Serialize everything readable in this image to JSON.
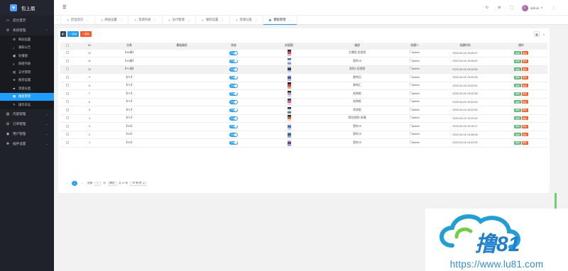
{
  "sidebar": {
    "brand": "包上届",
    "items": [
      {
        "label": "后台首页",
        "icon": "monitor-icon"
      },
      {
        "label": "系统管理",
        "icon": "gear-icon",
        "expanded": true,
        "children": [
          {
            "label": "网站设置",
            "icon": "gear-icon",
            "active": false
          },
          {
            "label": "通知公告",
            "icon": "bell-icon",
            "active": false
          },
          {
            "label": "轮播图",
            "icon": "image-icon",
            "active": false
          },
          {
            "label": "链接列表",
            "icon": "list-icon",
            "active": false
          },
          {
            "label": "支付管理",
            "icon": "card-icon",
            "active": false
          },
          {
            "label": "推荐设置",
            "icon": "star-icon",
            "active": false
          },
          {
            "label": "资源分类",
            "icon": "folder-icon",
            "active": false
          },
          {
            "label": "模板管理",
            "icon": "grid-icon",
            "active": true
          },
          {
            "label": "操作日志",
            "icon": "log-icon",
            "active": false
          }
        ]
      },
      {
        "label": "内容管理",
        "icon": "doc-icon"
      },
      {
        "label": "订单管理",
        "icon": "cart-icon"
      },
      {
        "label": "用户管理",
        "icon": "user-icon"
      },
      {
        "label": "插件设置",
        "icon": "plugin-icon"
      }
    ]
  },
  "header": {
    "menu_toggle": "☰",
    "user": "admin"
  },
  "tabs": [
    {
      "label": "后台首页",
      "active": false
    },
    {
      "label": "网站设置",
      "active": false
    },
    {
      "label": "资源列表",
      "active": false
    },
    {
      "label": "支付管理",
      "active": false
    },
    {
      "label": "推荐设置",
      "active": false
    },
    {
      "label": "资源分类",
      "active": false
    },
    {
      "label": "模板管理",
      "active": true
    }
  ],
  "toolbar": {
    "add": "+ 添加",
    "delete": "× 删除"
  },
  "table": {
    "headers": [
      "",
      "ID",
      "分类",
      "模板路径",
      "状态",
      "封面图",
      "描述",
      "创建人",
      "创建时间",
      "操作"
    ],
    "rows": [
      {
        "id": "12",
        "cat": "【H5端】",
        "desc": "主播我-短视频",
        "creator": "门admin",
        "time": "2022-04-04 15:45:37",
        "status": "开启",
        "thumb": [
          "#2a2a4a",
          "#c94a6b",
          "#f0b0c0"
        ]
      },
      {
        "id": "11",
        "cat": "【H5端】",
        "desc": "我的2E",
        "creator": "门admin",
        "time": "2022-04-04 15:45:52",
        "status": "开启",
        "thumb": [
          "#3a6fb0",
          "#e6e6f0",
          "#8a9ac8"
        ]
      },
      {
        "id": "10",
        "cat": "【PC端】",
        "desc": "我的2-短视频",
        "creator": "门admin",
        "time": "2022-04-04 15:44:56",
        "status": "开启",
        "thumb": [
          "#d0d0e0",
          "#2b3a6a",
          "#c0c8e0"
        ]
      },
      {
        "id": "9",
        "cat": "【PC】",
        "desc": "都商品",
        "creator": "门admin",
        "time": "2022-04-04 15:43:46",
        "status": "开启",
        "thumb": [
          "#e0e4f0",
          "#4a5a9a",
          "#a8b8e0"
        ]
      },
      {
        "id": "8",
        "cat": "【PC】",
        "desc": "都商汇",
        "creator": "门admin",
        "time": "2022-04-04 15:42:51",
        "status": "开启",
        "thumb": [
          "#1a1a2a",
          "#c84a5a",
          "#e8a060"
        ]
      },
      {
        "id": "7",
        "cat": "【PC】",
        "desc": "经典版",
        "creator": "门admin",
        "time": "2022-04-04 15:42:06",
        "status": "开启",
        "thumb": [
          "#2a2a3a",
          "#b8a0d0",
          "#e0e0f0"
        ]
      },
      {
        "id": "6",
        "cat": "【PC】",
        "desc": "经典版",
        "creator": "门admin",
        "time": "2022-04-04 15:33:49",
        "status": "开启",
        "thumb": [
          "#3a3a6a",
          "#e06080",
          "#f0d0d8"
        ]
      },
      {
        "id": "5",
        "cat": "【PC】",
        "desc": "简易版",
        "creator": "门admin",
        "time": "2022-04-04 15:32:50",
        "status": "开启",
        "thumb": [
          "#1a2a4a",
          "#e0e0e8",
          "#6a7ab0"
        ]
      },
      {
        "id": "4",
        "cat": "【PC】",
        "desc": "简短视频+直播",
        "creator": "门admin",
        "time": "2022-04-04 15:20:43",
        "status": "开启",
        "thumb": [
          "#2a2a2a",
          "#d07040",
          "#f0e0c0"
        ]
      },
      {
        "id": "3",
        "cat": "【H5】",
        "desc": "我的2E",
        "creator": "门admin",
        "time": "2022-04-04 15:15:17",
        "status": "开启",
        "thumb": [
          "#e8e8f0",
          "#4a70c0",
          "#c0c8e8"
        ]
      },
      {
        "id": "2",
        "cat": "【H5】",
        "desc": "我的2E",
        "creator": "门admin",
        "time": "2022-04-04 14:48:08",
        "status": "开启",
        "thumb": [
          "#f0f0f4",
          "#3a5a9a",
          "#90a0d0"
        ]
      },
      {
        "id": "1",
        "cat": "【H5】",
        "desc": "我的2E",
        "creator": "门admin",
        "time": "2022-04-04 14:32:05",
        "status": "开启",
        "thumb": [
          "#d8d8e8",
          "#5a4a8a",
          "#b0a0d8"
        ]
      }
    ],
    "op_edit": "编辑",
    "op_del": "删除"
  },
  "pager": {
    "prev": "‹",
    "current": "1",
    "next": "›",
    "goto_label": "到第",
    "page_value": "1",
    "page_unit": "页",
    "go": "确定",
    "total": "共 12 条",
    "per_page": "10 条/页"
  },
  "watermark": {
    "url": "https://www.lu81.com",
    "logo_text": "撸81"
  },
  "colors": {
    "accent": "#1e9fff",
    "sidebar": "#20222a",
    "edit": "#5fb878",
    "delete": "#ff5722"
  }
}
